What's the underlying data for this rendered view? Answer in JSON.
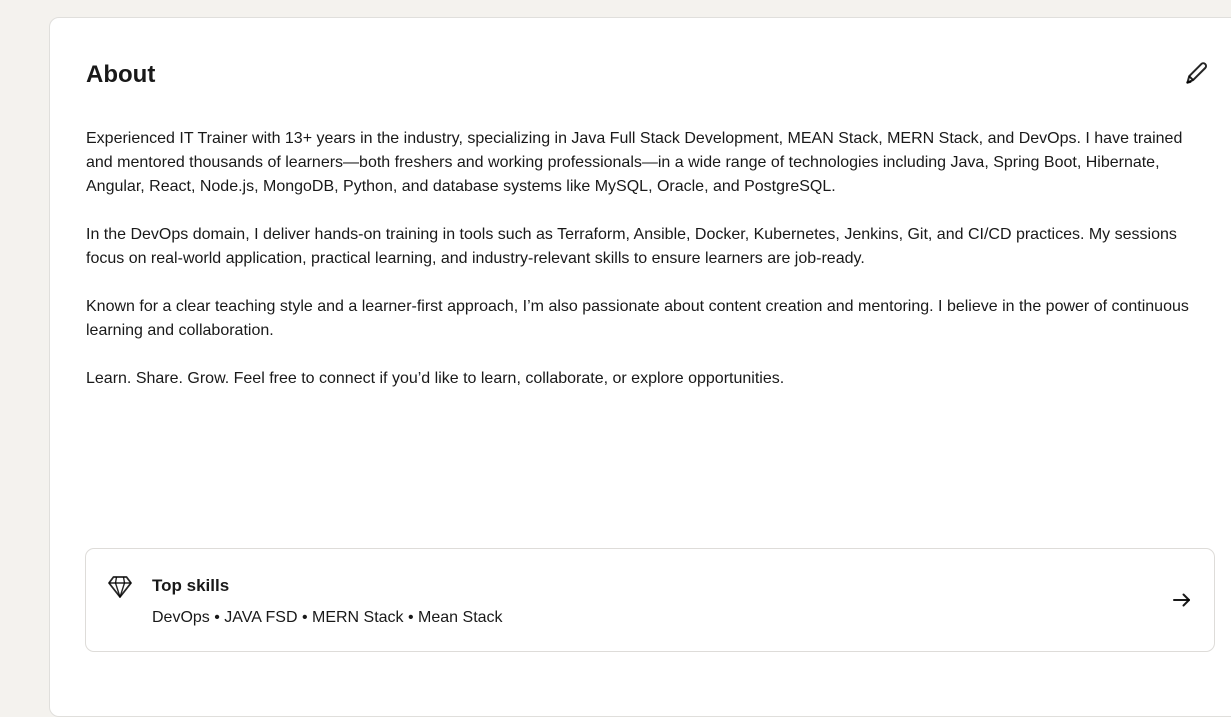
{
  "about": {
    "title": "About",
    "paragraphs": [
      "Experienced IT Trainer with 13+ years in the industry, specializing in Java Full Stack Development, MEAN Stack, MERN Stack, and DevOps. I have trained and mentored thousands of learners—both freshers and working professionals—in a wide range of technologies including Java, Spring Boot, Hibernate, Angular, React, Node.js, MongoDB, Python, and database systems like MySQL, Oracle, and PostgreSQL.",
      "In the DevOps domain, I deliver hands-on training in tools such as Terraform, Ansible, Docker, Kubernetes, Jenkins, Git, and CI/CD practices. My sessions focus on real-world application, practical learning, and industry-relevant skills to ensure learners are job-ready.",
      "Known for a clear teaching style and a learner-first approach, I’m also passionate about content creation and mentoring. I believe in the power of continuous learning and collaboration.",
      "Learn. Share. Grow. Feel free to connect if you’d like to learn, collaborate, or explore opportunities."
    ]
  },
  "top_skills": {
    "heading": "Top skills",
    "skills_line": "DevOps • JAVA FSD • MERN Stack • Mean Stack"
  },
  "icons": {
    "edit": "pencil-icon",
    "skills": "diamond-icon",
    "open": "arrow-right-icon"
  },
  "colors": {
    "page_background": "#f4f2ee",
    "card_background": "#ffffff",
    "border": "#e0dfdc",
    "text": "#191919"
  }
}
